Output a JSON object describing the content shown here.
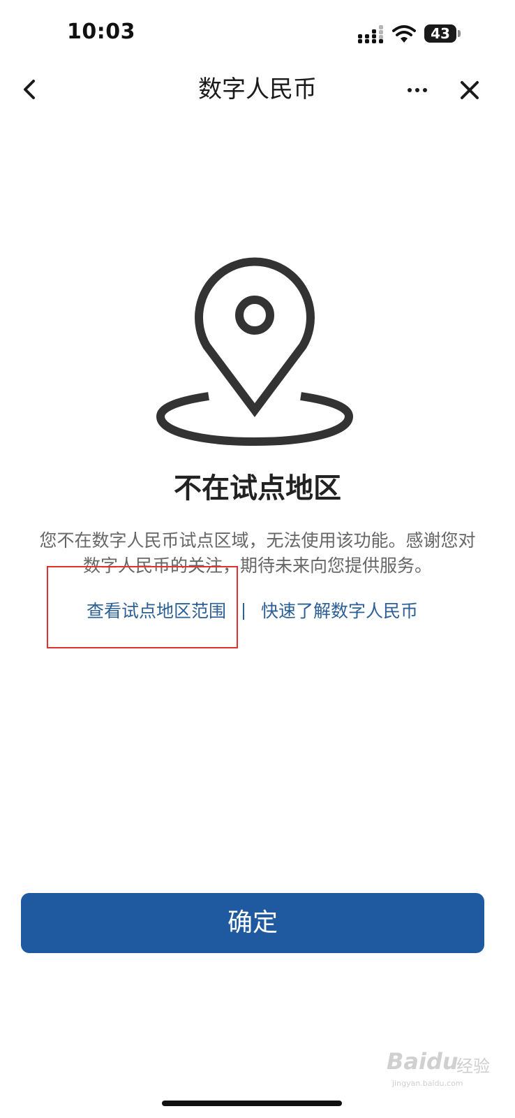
{
  "status_bar": {
    "time": "10:03",
    "battery": "43",
    "signal_icon": "cellular-signal-icon",
    "wifi_icon": "wifi-icon"
  },
  "nav": {
    "title": "数字人民币",
    "back_icon": "chevron-left-icon",
    "more_icon": "more-dots-icon",
    "close_icon": "close-icon"
  },
  "illustration": {
    "icon": "location-pin-icon"
  },
  "main": {
    "heading": "不在试点地区",
    "description": "您不在数字人民币试点区域，无法使用该功能。感谢您对数字人民币的关注，期待未来向您提供服务。",
    "link_pilot_areas": "查看试点地区范围",
    "link_learn": "快速了解数字人民币"
  },
  "footer": {
    "confirm_label": "确定"
  },
  "watermark": {
    "brand": "Baidu",
    "cn": "经验",
    "url": "jingyan.baidu.com"
  },
  "colors": {
    "primary_button": "#1f5aa0",
    "link": "#2b5f95",
    "highlight_border": "#e0322e",
    "heading_text": "#222222",
    "body_text": "#666666"
  }
}
